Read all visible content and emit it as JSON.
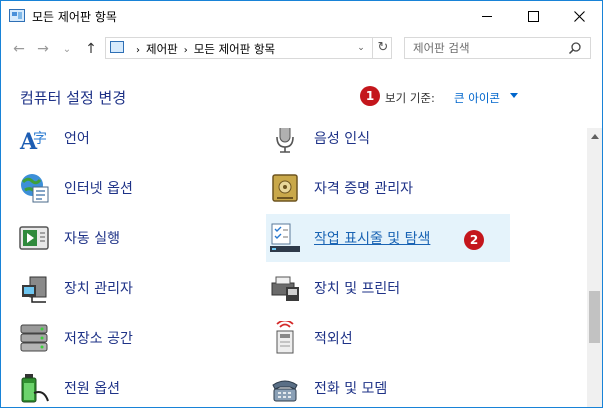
{
  "window": {
    "title": "모든 제어판 항목"
  },
  "address_bar": {
    "crumbs": [
      "제어판",
      "모든 제어판 항목"
    ],
    "refresh_glyph": "↻",
    "dropdown_glyph": "⌄"
  },
  "nav": {
    "back_glyph": "←",
    "forward_glyph": "→",
    "recent_glyph": "⌄",
    "up_glyph": "↑"
  },
  "search": {
    "placeholder": "제어판 검색"
  },
  "header": {
    "title": "컴퓨터 설정 변경",
    "view_by_label": "보기 기준:",
    "view_by_value": "큰 아이콘"
  },
  "badges": [
    "1",
    "2"
  ],
  "items": {
    "left": [
      {
        "label": "언어",
        "icon": "language-icon"
      },
      {
        "label": "인터넷 옵션",
        "icon": "internet-options-icon"
      },
      {
        "label": "자동 실행",
        "icon": "autoplay-icon"
      },
      {
        "label": "장치 관리자",
        "icon": "device-manager-icon"
      },
      {
        "label": "저장소 공간",
        "icon": "storage-spaces-icon"
      },
      {
        "label": "전원 옵션",
        "icon": "power-options-icon"
      }
    ],
    "right": [
      {
        "label": "음성 인식",
        "icon": "speech-recognition-icon"
      },
      {
        "label": "자격 증명 관리자",
        "icon": "credential-manager-icon"
      },
      {
        "label": "작업 표시줄 및 탐색",
        "icon": "taskbar-navigation-icon"
      },
      {
        "label": "장치 및 프린터",
        "icon": "devices-printers-icon"
      },
      {
        "label": "적외선",
        "icon": "infrared-icon"
      },
      {
        "label": "전화 및 모뎀",
        "icon": "phone-modem-icon"
      }
    ]
  },
  "colors": {
    "link": "#1e3287",
    "hover_bg": "#e5f3fb",
    "badge": "#c4161c",
    "accent": "#0066cc"
  }
}
